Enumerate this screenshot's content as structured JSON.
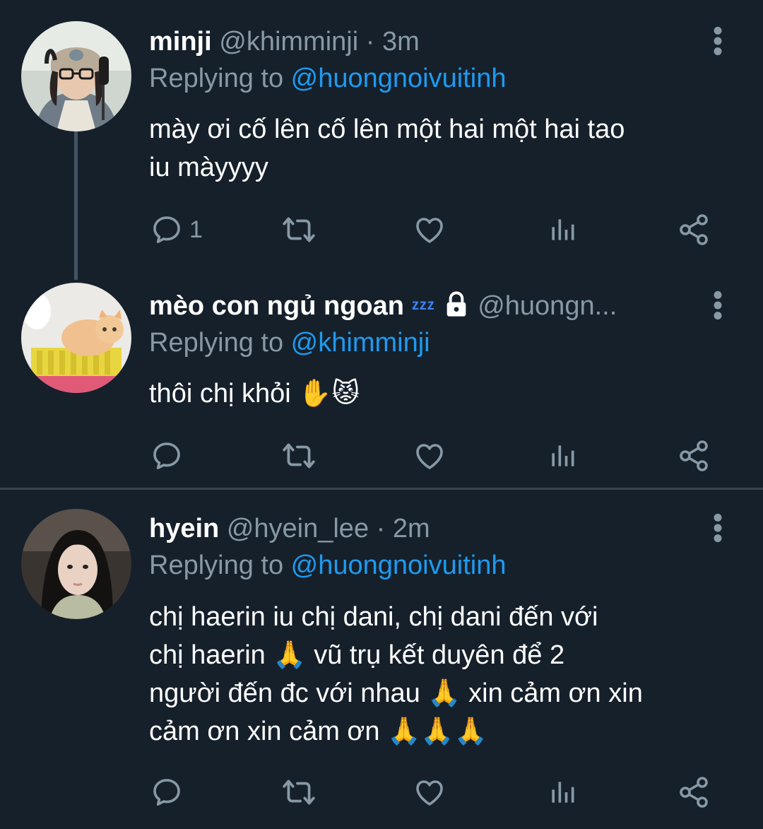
{
  "tweets": [
    {
      "name": "minji",
      "handle": "@khimminji",
      "sep": " · ",
      "time": "3m",
      "replying_prefix": "Replying to ",
      "replying_to": "@huongnoivuitinh",
      "text_lines": [
        "mày ơi cố lên cố lên một hai một hai tao",
        "iu màyyyy"
      ],
      "reply_count": "1"
    },
    {
      "name": "mèo con ngủ ngoan",
      "name_suffix": "ᶻᶻᶻ",
      "handle": "@huongn...",
      "replying_prefix": "Replying to ",
      "replying_to": "@khimminji",
      "text_lines": [
        "thôi chị khỏi ✋😾"
      ],
      "reply_count": ""
    },
    {
      "name": "hyein",
      "handle": "@hyein_lee",
      "sep": " · ",
      "time": "2m",
      "replying_prefix": "Replying to ",
      "replying_to": "@huongnoivuitinh",
      "text_lines": [
        "chị haerin iu chị dani, chị dani đến với",
        "chị haerin 🙏 vũ trụ kết duyên để 2",
        "người đến đc với nhau 🙏 xin cảm ơn xin",
        "cảm ơn xin cảm ơn 🙏🙏🙏"
      ],
      "reply_count": ""
    }
  ],
  "icons": {
    "reply": "reply-icon",
    "retweet": "retweet-icon",
    "like": "like-icon",
    "analytics": "analytics-icon",
    "share": "share-icon",
    "more": "more-vertical-icon",
    "lock": "lock-icon"
  },
  "colors": {
    "background": "#15202b",
    "muted": "#8899a6",
    "mention": "#1d9bf0",
    "divider": "#38444d"
  }
}
